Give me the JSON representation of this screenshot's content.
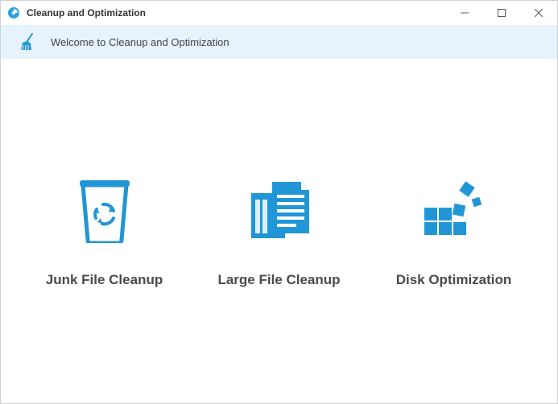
{
  "window": {
    "title": "Cleanup and Optimization"
  },
  "banner": {
    "welcome": "Welcome to Cleanup and Optimization"
  },
  "cards": {
    "junk": {
      "label": "Junk File Cleanup"
    },
    "large": {
      "label": "Large File Cleanup"
    },
    "disk": {
      "label": "Disk Optimization"
    }
  },
  "colors": {
    "accent": "#2196d6"
  }
}
